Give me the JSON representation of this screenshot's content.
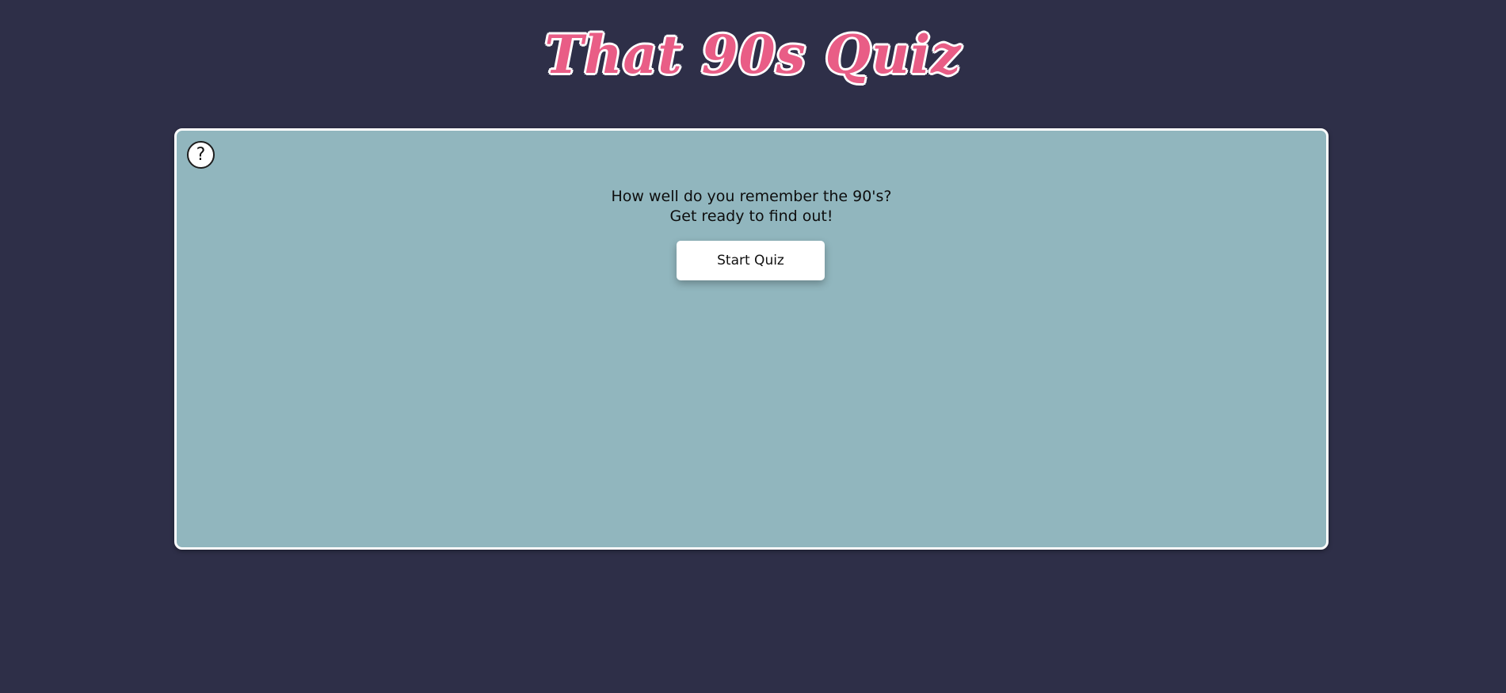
{
  "header": {
    "title": "That 90s Quiz"
  },
  "quiz_card": {
    "help_icon": "question-mark-circle-icon",
    "help_symbol": "?",
    "intro_line_1": "How well do you remember the 90's?",
    "intro_line_2": "Get ready to find out!",
    "start_label": "Start Quiz"
  },
  "colors": {
    "page_background": "#2e2f48",
    "title_pink": "#e95d86",
    "card_background": "#91b6be",
    "card_border": "#ffffff",
    "button_background": "#ffffff"
  }
}
